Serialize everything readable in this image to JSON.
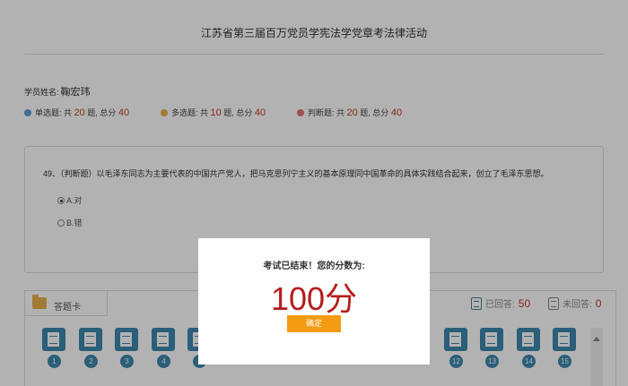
{
  "page": {
    "title": "江苏省第三届百万党员学宪法学党章考法律活动",
    "student_label": "学员姓名:",
    "student_name": "鞠宏玮"
  },
  "stats": {
    "single": {
      "label": "单选题: 共",
      "count": "20",
      "unit": "题, 总分",
      "score": "40",
      "color": "#5b9bd5"
    },
    "multi": {
      "label": "多选题: 共",
      "count": "10",
      "unit": "题, 总分",
      "score": "40",
      "color": "#e7b04b"
    },
    "judge": {
      "label": "判断题: 共",
      "count": "20",
      "unit": "题, 总分",
      "score": "40",
      "color": "#e57373"
    }
  },
  "question": {
    "text": "49、（判断题）以毛泽东同志为主要代表的中国共产党人，把马克思列宁主义的基本原理同中国革命的具体实践结合起来，创立了毛泽东思想。",
    "options": [
      "A.对",
      "B.错"
    ],
    "selected": 0
  },
  "answer_card": {
    "title": "答题卡",
    "answered_label": "已回答:",
    "answered_count": "50",
    "unanswered_label": "未回答:",
    "unanswered_count": "0",
    "numbers": [
      "1",
      "2",
      "3",
      "4",
      "5",
      "12",
      "13",
      "14",
      "15"
    ]
  },
  "modal": {
    "message": "考试已结束！您的分数为:",
    "score": "100分",
    "confirm_label": "确定",
    "button_color": "#f39c12"
  }
}
